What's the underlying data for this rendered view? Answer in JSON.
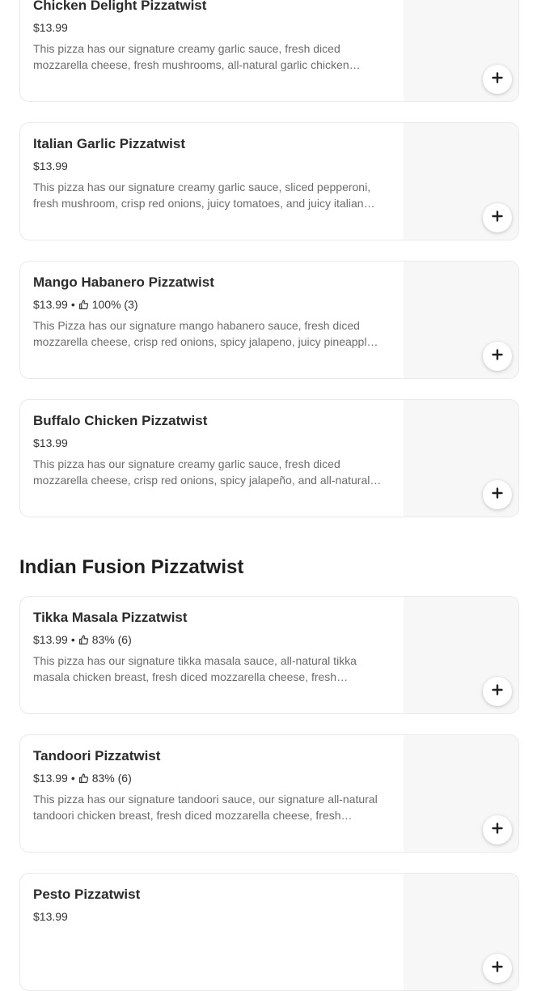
{
  "sections": [
    {
      "title": "",
      "items": [
        {
          "name": "Chicken Delight Pizzatwist",
          "price": "$13.99",
          "rating": null,
          "description": "This pizza has our signature creamy garlic sauce, fresh diced mozzarella cheese, fresh mushrooms, all-natural garlic chicken…"
        },
        {
          "name": "Italian Garlic Pizzatwist",
          "price": "$13.99",
          "rating": null,
          "description": "This pizza has our signature creamy garlic sauce, sliced pepperoni, fresh mushroom, crisp red onions, juicy tomatoes, and juicy italian…"
        },
        {
          "name": "Mango Habanero Pizzatwist",
          "price": "$13.99",
          "rating": "100% (3)",
          "description": "This Pizza has our signature mango habanero sauce, fresh diced mozzarella cheese, crisp red onions, spicy jalapeno, juicy pineappl…"
        },
        {
          "name": "Buffalo Chicken Pizzatwist",
          "price": "$13.99",
          "rating": null,
          "description": "This pizza has our signature creamy garlic sauce, fresh diced mozzarella cheese, crisp red onions, spicy jalapeño, and all-natural…"
        }
      ]
    },
    {
      "title": "Indian Fusion Pizzatwist",
      "items": [
        {
          "name": "Tikka Masala Pizzatwist",
          "price": "$13.99",
          "rating": "83% (6)",
          "description": "This pizza has our signature tikka masala sauce, all-natural tikka masala chicken breast, fresh diced mozzarella cheese, fresh…"
        },
        {
          "name": "Tandoori Pizzatwist",
          "price": "$13.99",
          "rating": "83% (6)",
          "description": "This pizza has our signature tandoori sauce, our signature all-natural tandoori chicken breast, fresh diced mozzarella cheese, fresh…"
        },
        {
          "name": "Pesto Pizzatwist",
          "price": "$13.99",
          "rating": null,
          "description": ""
        }
      ]
    }
  ],
  "rating_separator": "•",
  "icons": {
    "rating": "thumbs-up-icon",
    "add": "plus-icon"
  }
}
